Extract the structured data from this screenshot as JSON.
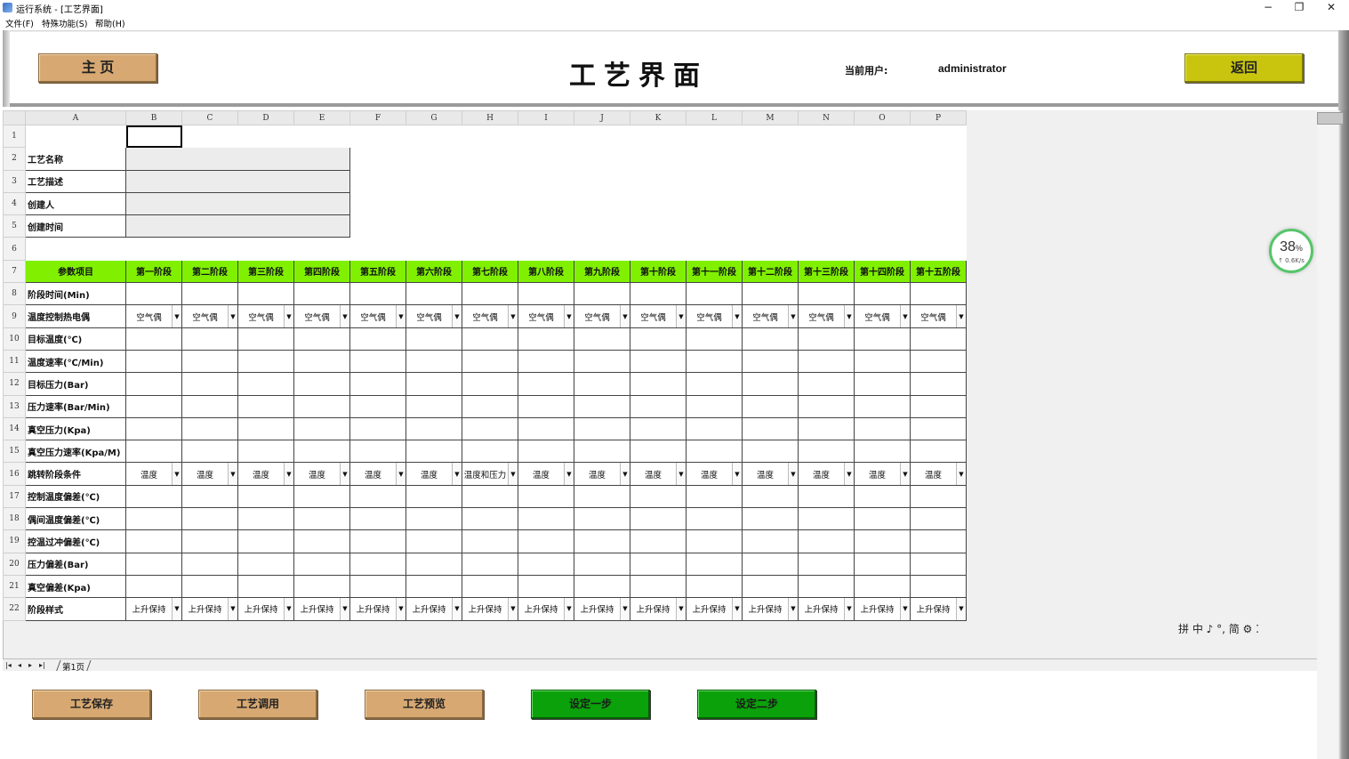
{
  "window": {
    "title": "运行系统 - [工艺界面]",
    "minimize": "−",
    "restore": "❐",
    "close": "✕"
  },
  "menu": [
    "文件(F)",
    "特殊功能(S)",
    "帮助(H)"
  ],
  "header": {
    "home_label": "主 页",
    "title": "工艺界面",
    "user_label": "当前用户:",
    "user_value": "administrator",
    "back_label": "返回"
  },
  "sheet": {
    "columns": [
      "A",
      "B",
      "C",
      "D",
      "E",
      "F",
      "G",
      "H",
      "I",
      "J",
      "K",
      "L",
      "M",
      "N",
      "O",
      "P"
    ],
    "row_numbers": [
      "1",
      "2",
      "3",
      "4",
      "5",
      "6",
      "7",
      "8",
      "9",
      "10",
      "11",
      "12",
      "13",
      "14",
      "15",
      "16",
      "17",
      "18",
      "19",
      "20",
      "21",
      "22"
    ],
    "info_labels": [
      "工艺名称",
      "工艺描述",
      "创建人",
      "创建时间"
    ],
    "param_header": "参数项目",
    "stages": [
      "第一阶段",
      "第二阶段",
      "第三阶段",
      "第四阶段",
      "第五阶段",
      "第六阶段",
      "第七阶段",
      "第八阶段",
      "第九阶段",
      "第十阶段",
      "第十一阶段",
      "第十二阶段",
      "第十三阶段",
      "第十四阶段",
      "第十五阶段"
    ],
    "params": [
      {
        "label": "阶段时间(Min)",
        "type": "blank"
      },
      {
        "label": "温度控制热电偶",
        "type": "dropdown",
        "values": [
          "空气偶",
          "空气偶",
          "空气偶",
          "空气偶",
          "空气偶",
          "空气偶",
          "空气偶",
          "空气偶",
          "空气偶",
          "空气偶",
          "空气偶",
          "空气偶",
          "空气偶",
          "空气偶",
          "空气偶"
        ]
      },
      {
        "label": "目标温度(℃)",
        "type": "blank"
      },
      {
        "label": "温度速率(℃/Min)",
        "type": "blank"
      },
      {
        "label": "目标压力(Bar)",
        "type": "blank"
      },
      {
        "label": "压力速率(Bar/Min)",
        "type": "blank"
      },
      {
        "label": "真空压力(Kpa)",
        "type": "blank"
      },
      {
        "label": "真空压力速率(Kpa/M)",
        "type": "blank"
      },
      {
        "label": "跳转阶段条件",
        "type": "dropdown",
        "values": [
          "温度",
          "温度",
          "温度",
          "温度",
          "温度",
          "温度",
          "温度和压力",
          "温度",
          "温度",
          "温度",
          "温度",
          "温度",
          "温度",
          "温度",
          "温度"
        ]
      },
      {
        "label": "控制温度偏差(℃)",
        "type": "blank"
      },
      {
        "label": "偶间温度偏差(℃)",
        "type": "blank"
      },
      {
        "label": "控温过冲偏差(℃)",
        "type": "blank"
      },
      {
        "label": "压力偏差(Bar)",
        "type": "blank"
      },
      {
        "label": "真空偏差(Kpa)",
        "type": "blank"
      },
      {
        "label": "阶段样式",
        "type": "dropdown",
        "values": [
          "上升保持",
          "上升保持",
          "上升保持",
          "上升保持",
          "上升保持",
          "上升保持",
          "上升保持",
          "上升保持",
          "上升保持",
          "上升保持",
          "上升保持",
          "上升保持",
          "上升保持",
          "上升保持",
          "上升保持"
        ]
      }
    ],
    "dropdown_arrow": "▼",
    "tab_name": "第1页"
  },
  "tabnav": [
    "|◂",
    "◂",
    "▸",
    "▸|"
  ],
  "ime_text": "拼 中 ♪ °, 简 ⚙ ⁚",
  "speed": {
    "percent": "38",
    "percent_sign": "%",
    "rate": "↑ 0.6K/s"
  },
  "buttons": {
    "save": "工艺保存",
    "load": "工艺调用",
    "preview": "工艺预览",
    "step1": "设定一步",
    "step2": "设定二步"
  },
  "colors": {
    "tan_button": "#d7a872",
    "back_button": "#c9c50f",
    "green_header": "#80f000",
    "green_button": "#0aa10a",
    "info_fill": "#ececec"
  }
}
